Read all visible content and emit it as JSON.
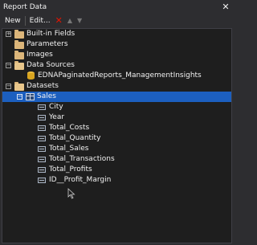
{
  "window": {
    "title": "Report Data",
    "close_glyph": "✕"
  },
  "toolbar": {
    "new_label": "New",
    "edit_label": "Edit...",
    "delete_glyph": "✕",
    "up_glyph": "▲",
    "down_glyph": "▼"
  },
  "tree": {
    "items": [
      {
        "label": "Built-in Fields"
      },
      {
        "label": "Parameters"
      },
      {
        "label": "Images"
      },
      {
        "label": "Data Sources"
      },
      {
        "label": "EDNAPaginatedReports_ManagementInsights"
      },
      {
        "label": "Datasets"
      },
      {
        "label": "Sales"
      },
      {
        "label": "City"
      },
      {
        "label": "Year"
      },
      {
        "label": "Total_Costs"
      },
      {
        "label": "Total_Quantity"
      },
      {
        "label": "Total_Sales"
      },
      {
        "label": "Total_Transactions"
      },
      {
        "label": "Total_Profits"
      },
      {
        "label": "ID__Profit_Margin"
      }
    ],
    "expander_collapsed": "+",
    "expander_expanded": "−"
  },
  "colors": {
    "selection": "#1c5fbf",
    "background": "#1e1e1e",
    "chrome": "#2d2d30",
    "delete": "#e51400"
  }
}
